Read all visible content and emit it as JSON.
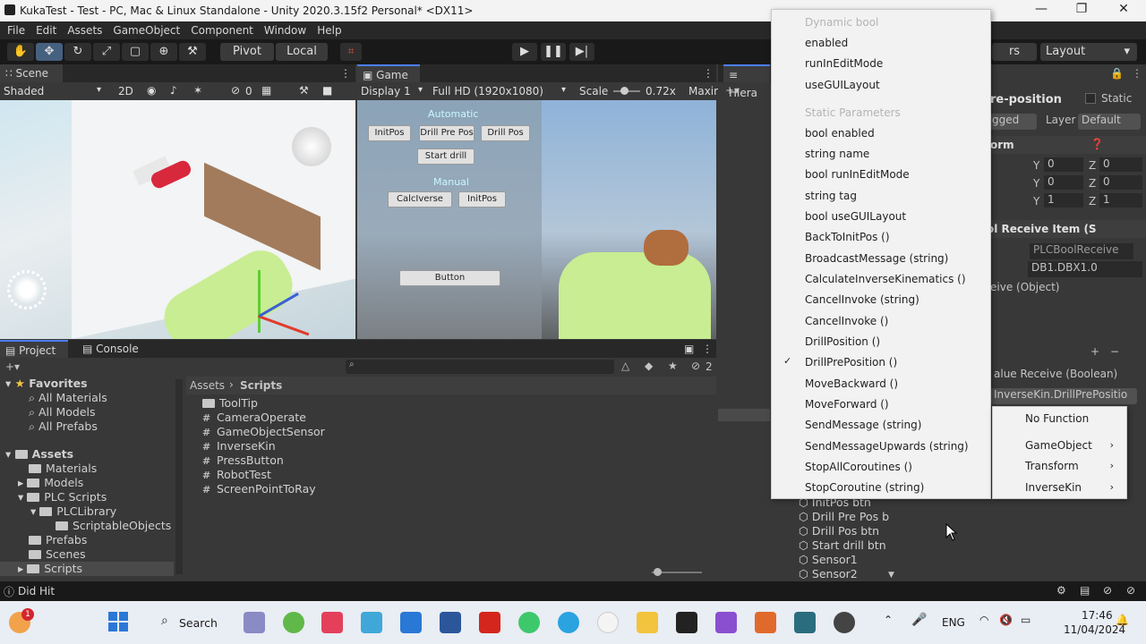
{
  "window": {
    "title": "KukaTest - Test - PC, Mac & Linux Standalone - Unity 2020.3.15f2 Personal* <DX11>"
  },
  "menubar": [
    "File",
    "Edit",
    "Assets",
    "GameObject",
    "Component",
    "Window",
    "Help"
  ],
  "toolbar": {
    "pivot": "Pivot",
    "local": "Local",
    "layers_partial": "rs",
    "layout": "Layout"
  },
  "scene": {
    "tab": "Scene",
    "shading": "Shaded",
    "mode2d": "2D",
    "hidden_count": "0"
  },
  "game": {
    "tab": "Game",
    "display": "Display 1",
    "resolution": "Full HD (1920x1080)",
    "scale_label": "Scale",
    "scale_value": "0.72x",
    "maximize": "Maxir",
    "automatic_label": "Automatic",
    "manual_label": "Manual",
    "buttons": {
      "initpos": "InitPos",
      "drill_pre_pos": "Drill Pre Pos",
      "drill_pos": "Drill Pos",
      "start_drill": "Start drill",
      "calcinverse": "CalcIverse",
      "initpos2": "InitPos",
      "button": "Button"
    }
  },
  "hierarchy": {
    "tab": "Hiera",
    "items": [
      "InitPos btn",
      "Drill Pre Pos b",
      "Drill Pos btn",
      "Start drill btn",
      "Sensor1",
      "Sensor2"
    ]
  },
  "inspector": {
    "name_partial": "re-position",
    "static": "Static",
    "tag_partial": "gged",
    "layer_label": "Layer",
    "layer_value": "Default",
    "transform_partial": "orm",
    "pos": {
      "y": "0",
      "z": "0"
    },
    "rot": {
      "y": "0",
      "z": "0"
    },
    "scale": {
      "y": "1",
      "z": "1"
    },
    "component_partial": "ol Receive Item (S",
    "script_ref": "PLCBoolReceive",
    "address": "DB1.DBX1.0",
    "event_partial": "eive (Object)",
    "value_receive_partial": "alue Receive (Boolean)",
    "function_selected": "InverseKin.DrillPrePositio"
  },
  "project": {
    "tab": "Project",
    "console_tab": "Console",
    "hidden_count": "2",
    "favorites": {
      "label": "Favorites",
      "items": [
        "All Materials",
        "All Models",
        "All Prefabs"
      ]
    },
    "assets": {
      "label": "Assets",
      "items": [
        "Materials",
        "Models",
        "PLC Scripts",
        "PLCLibrary",
        "ScriptableObjects",
        "Prefabs",
        "Scenes",
        "Scripts"
      ]
    },
    "breadcrumb": [
      "Assets",
      "Scripts"
    ],
    "files": [
      {
        "name": "ToolTip",
        "kind": "folder"
      },
      {
        "name": "CameraOperate",
        "kind": "script"
      },
      {
        "name": "GameObjectSensor",
        "kind": "script"
      },
      {
        "name": "InverseKin",
        "kind": "script"
      },
      {
        "name": "PressButton",
        "kind": "script"
      },
      {
        "name": "RobotTest",
        "kind": "script"
      },
      {
        "name": "ScreenPointToRay",
        "kind": "script"
      }
    ]
  },
  "status": {
    "message": "Did Hit"
  },
  "dropdown": {
    "dynamic_header": "Dynamic bool",
    "dynamic_items": [
      "enabled",
      "runInEditMode",
      "useGUILayout"
    ],
    "static_header": "Static Parameters",
    "static_items": [
      "bool enabled",
      "string name",
      "bool runInEditMode",
      "string tag",
      "bool useGUILayout",
      "BackToInitPos ()",
      "BroadcastMessage (string)",
      "CalculateInverseKinematics ()",
      "CancelInvoke (string)",
      "CancelInvoke ()",
      "DrillPosition ()",
      "DrillPrePosition ()",
      "MoveBackward ()",
      "MoveForward ()",
      "SendMessage (string)",
      "SendMessageUpwards (string)",
      "StopAllCoroutines ()",
      "StopCoroutine (string)"
    ],
    "checked": "DrillPrePosition ()"
  },
  "submenu": {
    "items": [
      "No Function",
      "GameObject",
      "Transform",
      "InverseKin"
    ]
  },
  "taskbar": {
    "search": "Search",
    "lang": "ENG",
    "time": "17:46",
    "date": "11/04/2024",
    "notification_count": "1"
  },
  "colors": {
    "accent": "#4c7eff",
    "taskbar_bg": "#e9edf4",
    "menu_bg": "#f2f2f2"
  }
}
